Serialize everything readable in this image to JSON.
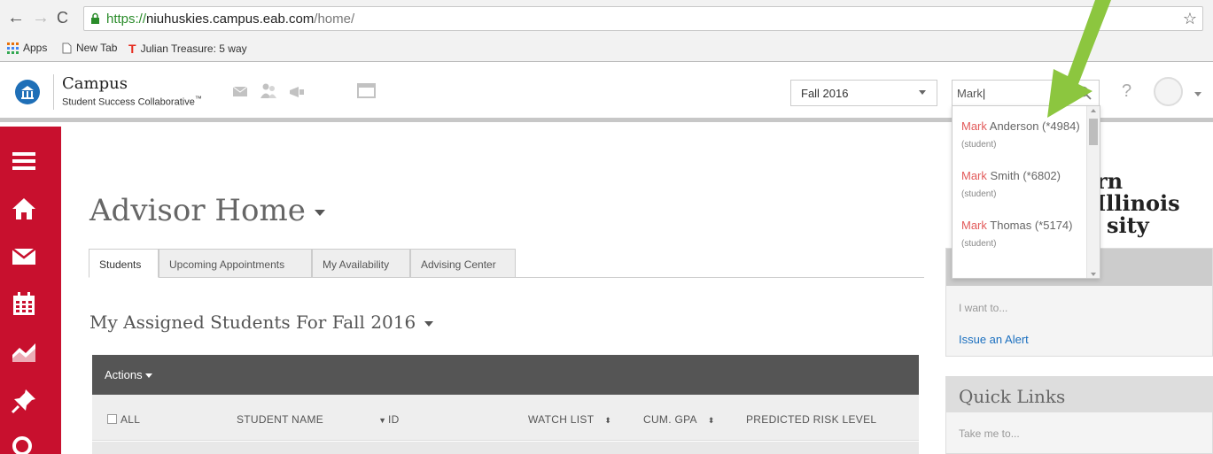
{
  "browser": {
    "url_protocol": "https://",
    "url_host": "niuhuskies.campus.eab.com",
    "url_path": "/home/",
    "bookmarks": [
      {
        "label": "Apps"
      },
      {
        "label": "New Tab"
      },
      {
        "label": "Julian Treasure: 5 way"
      }
    ]
  },
  "header": {
    "brand_title": "Campus",
    "brand_subtitle": "Student Success Collaborative",
    "brand_tm": "™",
    "term_selected": "Fall 2016",
    "search_value": "Mark",
    "help_label": "?"
  },
  "search_results": [
    {
      "match": "Mark",
      "rest": " Anderson (*4984)",
      "tag": "(student)"
    },
    {
      "match": "Mark",
      "rest": " Smith (*6802)",
      "tag": "(student)"
    },
    {
      "match": "Mark",
      "rest": " Thomas (*5174)",
      "tag": "(student)"
    }
  ],
  "main": {
    "page_title": "Advisor Home",
    "tabs": [
      {
        "label": "Students"
      },
      {
        "label": "Upcoming Appointments"
      },
      {
        "label": "My Availability"
      },
      {
        "label": "Advising Center"
      }
    ],
    "section_title": "My Assigned Students For Fall 2016",
    "actions_label": "Actions",
    "columns": [
      {
        "label": "ALL"
      },
      {
        "label": "STUDENT NAME"
      },
      {
        "label": "ID"
      },
      {
        "label": "WATCH LIST"
      },
      {
        "label": "CUM. GPA"
      },
      {
        "label": "PREDICTED RISK LEVEL"
      }
    ]
  },
  "right": {
    "university_line1": "rn Illinois",
    "university_line2": "sity",
    "panel1_sub": "I want to...",
    "panel1_link": "Issue an Alert",
    "panel2_title": "Quick Links",
    "panel2_sub": "Take me to..."
  },
  "colors": {
    "sidebar_red": "#c8102e",
    "highlight_red": "#e25a5a",
    "link_blue": "#1a6fbf",
    "arrow_green": "#8cc63f"
  }
}
